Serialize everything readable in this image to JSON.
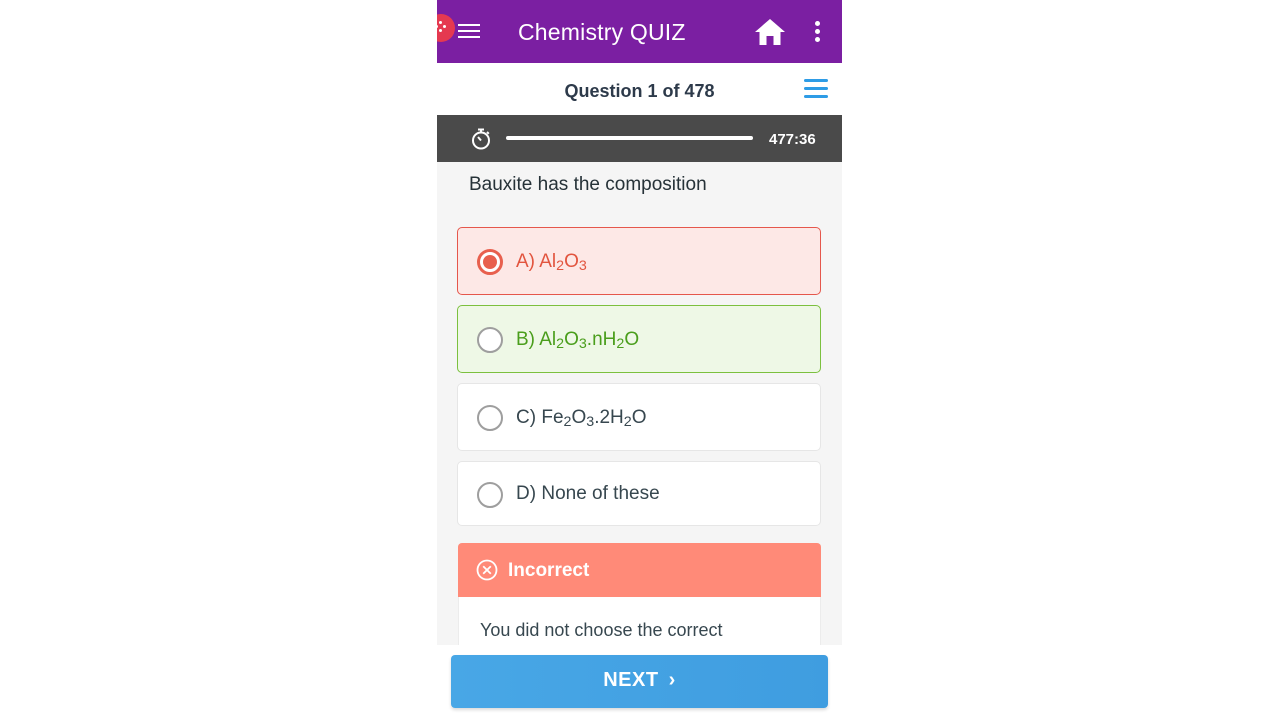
{
  "app_bar": {
    "title": "Chemistry QUIZ",
    "icons": [
      "menu-icon",
      "home-icon",
      "more-vert-icon"
    ]
  },
  "quiz": {
    "progress_label": "Question 1 of 478",
    "timer": "477:36",
    "timer_fraction": 1.0
  },
  "question": {
    "text": "Bauxite has the composition"
  },
  "options": [
    {
      "letter": "A)",
      "parts": [
        "Al",
        "2",
        "O",
        "3"
      ],
      "state": "selected-incorrect"
    },
    {
      "letter": "B)",
      "parts": [
        "Al",
        "2",
        "O",
        "3",
        ".nH",
        "2",
        "O"
      ],
      "state": "correct"
    },
    {
      "letter": "C)",
      "parts": [
        "Fe",
        "2",
        "O",
        "3",
        ".2H",
        "2",
        "O"
      ],
      "state": "default"
    },
    {
      "letter": "D)",
      "parts": [
        "None of these"
      ],
      "state": "default"
    }
  ],
  "feedback": {
    "title": "Incorrect",
    "message": "You did not choose the correct"
  },
  "actions": {
    "next_label": "NEXT",
    "next_chevron": "›"
  },
  "colors": {
    "app_bar": "#7b1fa2",
    "incorrect": "#e8604e",
    "correct": "#7cc03f",
    "feedback_header": "#ff8a78",
    "next_button": "#45a4e4",
    "timer_bar": "#4a4a4a"
  }
}
